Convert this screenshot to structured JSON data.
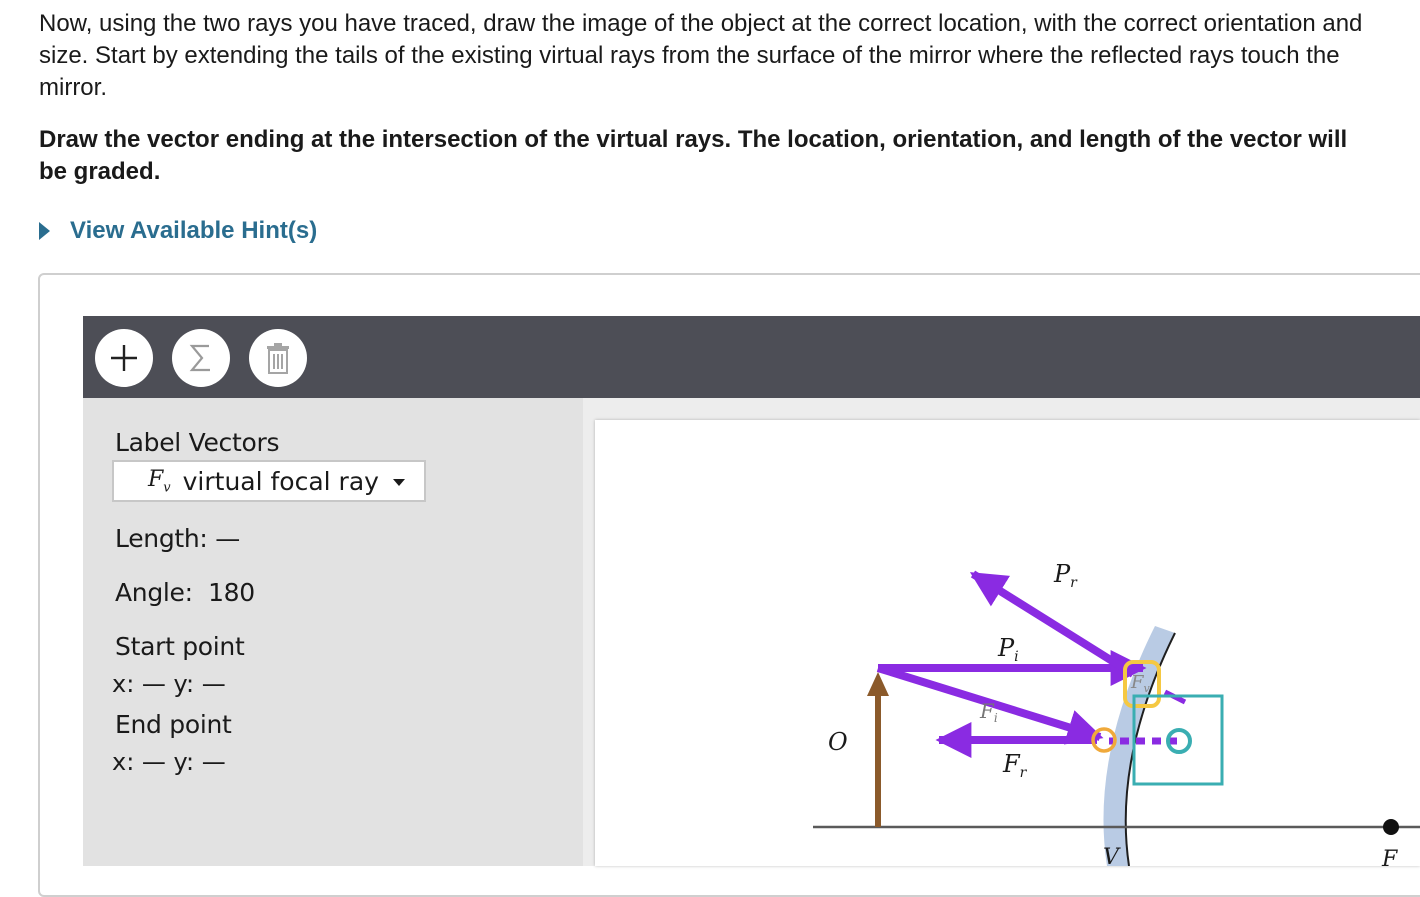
{
  "instructions": {
    "paragraph": "Now, using the two rays you have traced, draw the image of the object at the correct location, with the correct orientation and size. Start by extending the tails of the existing virtual rays from the surface of the mirror where the reflected rays touch the mirror.",
    "bold": "Draw the vector ending at the intersection of the virtual rays. The location, orientation, and length of the vector will be graded."
  },
  "hint": {
    "label": "View Available Hint(s)"
  },
  "toolbar": {
    "add": "plus-icon",
    "sum": "sigma-icon",
    "delete": "trash-icon"
  },
  "sidebar": {
    "label_vectors": "Label Vectors",
    "selected_symbol": "F",
    "selected_subscript": "v",
    "selected_label": "virtual focal ray",
    "length_label": "Length:",
    "length_value": "—",
    "angle_label": "Angle:",
    "angle_value": "180",
    "start_label": "Start point",
    "start_coords": "x: — y: —",
    "end_label": "End point",
    "end_coords": "x: — y: —"
  },
  "diagram": {
    "object_label": "O",
    "vertex_label": "V",
    "focal_label": "F",
    "ray_labels": {
      "pr_main": "P",
      "pr_sub": "r",
      "pi_main": "P",
      "pi_sub": "i",
      "fi_main": "F",
      "fi_sub": "i",
      "fr_main": "F",
      "fr_sub": "r",
      "fv_main": "F",
      "fv_sub": "v"
    },
    "colors": {
      "ray": "#8a2be2",
      "object": "#8b5a2b",
      "mirror": "#b9cbe4",
      "handle_orange": "#f0a93a",
      "handle_yellow": "#f5c842",
      "handle_teal": "#3aaeb2"
    }
  }
}
